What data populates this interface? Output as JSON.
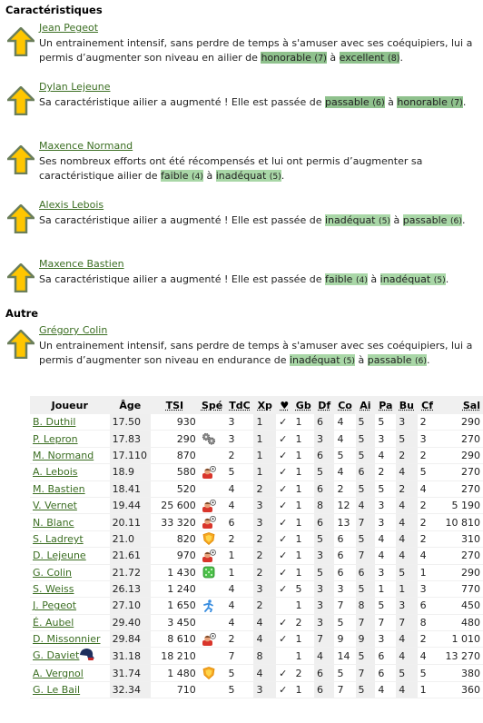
{
  "sections": [
    {
      "title": "Caractéristiques",
      "entries": [
        {
          "player": "Jean Pegeot",
          "text_before": "Un entrainement intensif, sans perdre de temps à s'amuser avec ses coéquipiers, lui a permis d’augmenter son niveau en ailier de ",
          "from_label": "honorable",
          "from_level": "(7)",
          "middle": " à ",
          "to_label": "excellent",
          "to_level": "(8)",
          "end": "."
        },
        {
          "player": "Dylan Lejeune",
          "text_before": "Sa caractéristique ailier a augmenté ! Elle est passée de ",
          "from_label": "passable",
          "from_level": "(6)",
          "middle": " à ",
          "to_label": "honorable",
          "to_level": "(7)",
          "end": "."
        },
        {
          "player": "Maxence Normand",
          "text_before": "Ses nombreux efforts ont été récompensés et lui ont permis d’augmenter sa caractéristique ailier de ",
          "from_label": "faible",
          "from_level": "(4)",
          "middle": " à ",
          "to_label": "inadéquat",
          "to_level": "(5)",
          "end": "."
        },
        {
          "player": "Alexis Lebois",
          "text_before": "Sa caractéristique ailier a augmenté ! Elle est passée de ",
          "from_label": "inadéquat",
          "from_level": "(5)",
          "middle": " à ",
          "to_label": "passable",
          "to_level": "(6)",
          "end": "."
        },
        {
          "player": "Maxence Bastien",
          "text_before": "Sa caractéristique ailier a augmenté ! Elle est passée de ",
          "from_label": "faible",
          "from_level": "(4)",
          "middle": " à ",
          "to_label": "inadéquat",
          "to_level": "(5)",
          "end": "."
        }
      ]
    },
    {
      "title": "Autre",
      "entries": [
        {
          "player": "Grégory Colin",
          "text_before": "Un entrainement intensif, sans perdre de temps à s'amuser avec ses coéquipiers, lui a permis d’augmenter son niveau en endurance de ",
          "from_label": "inadéquat",
          "from_level": "(5)",
          "middle": " à ",
          "to_label": "passable",
          "to_level": "(6)",
          "end": "."
        }
      ]
    }
  ],
  "icons": {
    "progress": "up-arrow-icon"
  },
  "colors": {
    "link": "#3b6e22",
    "highlight": "#8fc18d",
    "highlight_light": "#a9d7a7",
    "arrow_fill": "#ffc600",
    "arrow_border": "#6b7f5a"
  },
  "table": {
    "headers": [
      "Joueur",
      "Âge",
      "TSI",
      "Spé",
      "TdC",
      "Xp",
      "♥",
      "Gb",
      "Df",
      "Co",
      "Ai",
      "Pa",
      "Bu",
      "Cf",
      "Sal"
    ],
    "rows": [
      {
        "name": "B. Duthil",
        "age": "17.50",
        "tsi": "930",
        "spe": "",
        "tdc": "3",
        "xp": "1",
        "heart": "✓",
        "gb": "1",
        "df": "6",
        "co": "4",
        "ai": "5",
        "pa": "5",
        "bu": "3",
        "cf": "2",
        "sal": "290"
      },
      {
        "name": "P. Lepron",
        "age": "17.83",
        "tsi": "290",
        "spe": "technical",
        "tdc": "3",
        "xp": "1",
        "heart": "✓",
        "gb": "1",
        "df": "3",
        "co": "4",
        "ai": "5",
        "pa": "3",
        "bu": "5",
        "cf": "3",
        "sal": "270"
      },
      {
        "name": "M. Normand",
        "age": "17.110",
        "tsi": "870",
        "spe": "",
        "tdc": "2",
        "xp": "1",
        "heart": "✓",
        "gb": "1",
        "df": "6",
        "co": "5",
        "ai": "5",
        "pa": "4",
        "bu": "2",
        "cf": "2",
        "sal": "290"
      },
      {
        "name": "A. Lebois",
        "age": "18.9",
        "tsi": "580",
        "spe": "head",
        "tdc": "5",
        "xp": "1",
        "heart": "✓",
        "gb": "1",
        "df": "5",
        "co": "4",
        "ai": "6",
        "pa": "2",
        "bu": "4",
        "cf": "5",
        "sal": "270"
      },
      {
        "name": "M. Bastien",
        "age": "18.41",
        "tsi": "520",
        "spe": "",
        "tdc": "4",
        "xp": "2",
        "heart": "✓",
        "gb": "1",
        "df": "6",
        "co": "2",
        "ai": "5",
        "pa": "5",
        "bu": "2",
        "cf": "4",
        "sal": "270"
      },
      {
        "name": "V. Vernet",
        "age": "19.44",
        "tsi": "25 600",
        "spe": "head",
        "tdc": "4",
        "xp": "3",
        "heart": "✓",
        "gb": "1",
        "df": "8",
        "co": "12",
        "ai": "4",
        "pa": "3",
        "bu": "4",
        "cf": "2",
        "sal": "5 190"
      },
      {
        "name": "N. Blanc",
        "age": "20.11",
        "tsi": "33 320",
        "spe": "head",
        "tdc": "6",
        "xp": "3",
        "heart": "✓",
        "gb": "1",
        "df": "6",
        "co": "13",
        "ai": "7",
        "pa": "3",
        "bu": "4",
        "cf": "2",
        "sal": "10 810"
      },
      {
        "name": "S. Ladreyt",
        "age": "21.0",
        "tsi": "820",
        "spe": "powerful",
        "tdc": "2",
        "xp": "2",
        "heart": "✓",
        "gb": "1",
        "df": "5",
        "co": "6",
        "ai": "5",
        "pa": "4",
        "bu": "4",
        "cf": "2",
        "sal": "310"
      },
      {
        "name": "D. Lejeune",
        "age": "21.61",
        "tsi": "970",
        "spe": "head",
        "tdc": "1",
        "xp": "2",
        "heart": "✓",
        "gb": "1",
        "df": "3",
        "co": "6",
        "ai": "7",
        "pa": "4",
        "bu": "4",
        "cf": "4",
        "sal": "270"
      },
      {
        "name": "G. Colin",
        "age": "21.72",
        "tsi": "1 430",
        "spe": "unpredictable",
        "tdc": "1",
        "xp": "2",
        "heart": "✓",
        "gb": "1",
        "df": "5",
        "co": "6",
        "ai": "6",
        "pa": "3",
        "bu": "5",
        "cf": "1",
        "sal": "290"
      },
      {
        "name": "S. Weiss",
        "age": "26.13",
        "tsi": "1 240",
        "spe": "",
        "tdc": "4",
        "xp": "3",
        "heart": "✓",
        "gb": "5",
        "df": "3",
        "co": "3",
        "ai": "5",
        "pa": "1",
        "bu": "1",
        "cf": "3",
        "sal": "770"
      },
      {
        "name": "J. Pegeot",
        "age": "27.10",
        "tsi": "1 650",
        "spe": "quick",
        "tdc": "4",
        "xp": "2",
        "heart": "",
        "gb": "1",
        "df": "3",
        "co": "7",
        "ai": "8",
        "pa": "5",
        "bu": "3",
        "cf": "6",
        "sal": "450"
      },
      {
        "name": "É. Aubel",
        "age": "29.40",
        "tsi": "3 450",
        "spe": "",
        "tdc": "4",
        "xp": "4",
        "heart": "✓",
        "gb": "2",
        "df": "3",
        "co": "5",
        "ai": "7",
        "pa": "7",
        "bu": "7",
        "cf": "8",
        "sal": "480"
      },
      {
        "name": "D. Missonnier",
        "age": "29.84",
        "tsi": "8 610",
        "spe": "head",
        "tdc": "2",
        "xp": "4",
        "heart": "✓",
        "gb": "1",
        "df": "7",
        "co": "9",
        "ai": "9",
        "pa": "3",
        "bu": "4",
        "cf": "2",
        "sal": "1 010"
      },
      {
        "name": "G. Daviet",
        "age": "31.18",
        "tsi": "18 210",
        "spe": "",
        "tdc": "7",
        "xp": "8",
        "heart": "",
        "gb": "1",
        "df": "4",
        "co": "14",
        "ai": "5",
        "pa": "6",
        "bu": "4",
        "cf": "4",
        "sal": "13 270",
        "badge": "captain-cap"
      },
      {
        "name": "A. Vergnol",
        "age": "31.74",
        "tsi": "1 480",
        "spe": "powerful",
        "tdc": "5",
        "xp": "4",
        "heart": "✓",
        "gb": "2",
        "df": "6",
        "co": "5",
        "ai": "7",
        "pa": "6",
        "bu": "5",
        "cf": "5",
        "sal": "380"
      },
      {
        "name": "G. Le Bail",
        "age": "32.34",
        "tsi": "710",
        "spe": "",
        "tdc": "5",
        "xp": "3",
        "heart": "✓",
        "gb": "1",
        "df": "6",
        "co": "7",
        "ai": "5",
        "pa": "4",
        "bu": "4",
        "cf": "1",
        "sal": "360"
      }
    ]
  }
}
